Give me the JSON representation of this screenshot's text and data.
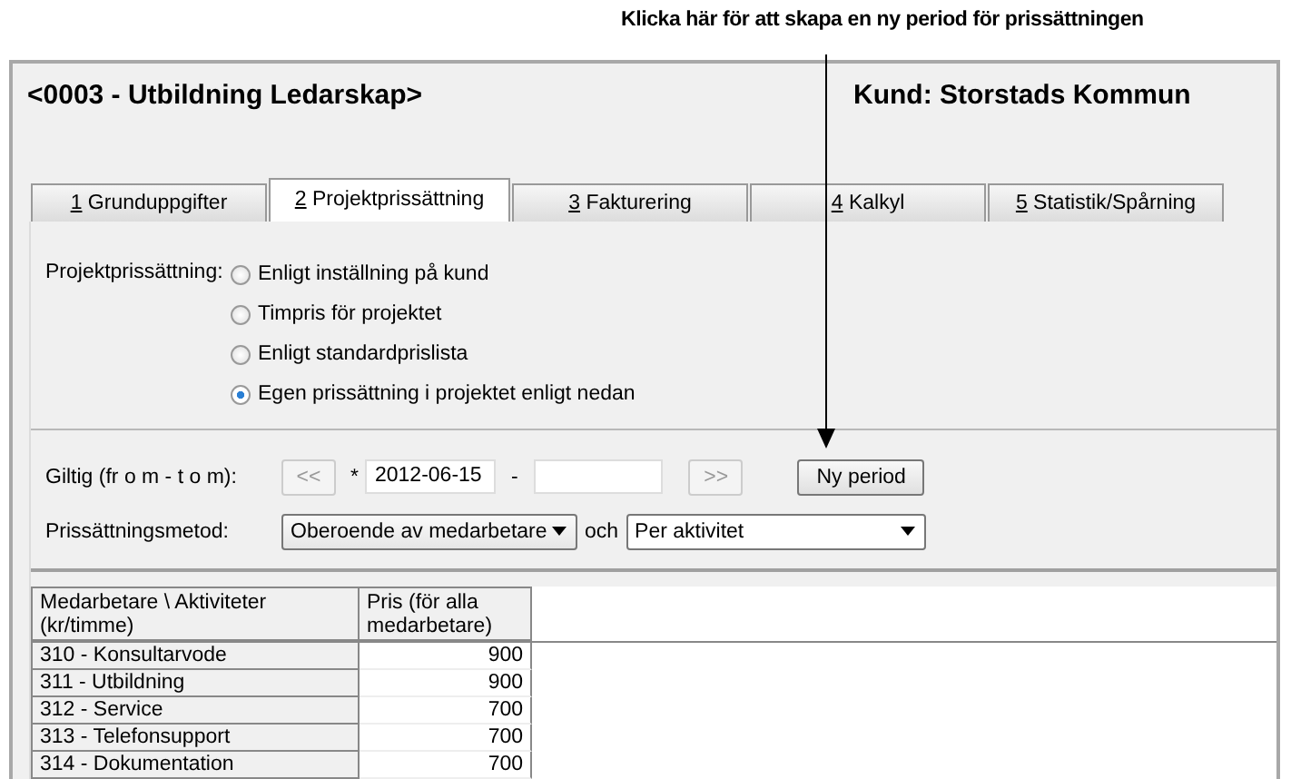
{
  "annotation": {
    "text": "Klicka här för att skapa en ny period för prissättningen"
  },
  "header": {
    "project": "<0003 - Utbildning Ledarskap>",
    "customer": "Kund: Storstads Kommun"
  },
  "tabs": [
    {
      "key": "1",
      "label": " Grunduppgifter",
      "selected": false
    },
    {
      "key": "2",
      "label": " Projektprissättning",
      "selected": true
    },
    {
      "key": "3",
      "label": " Fakturering",
      "selected": false
    },
    {
      "key": "4",
      "label": " Kalkyl",
      "selected": false
    },
    {
      "key": "5",
      "label": " Statistik/Spårning",
      "selected": false
    }
  ],
  "pricing": {
    "label": "Projektprissättning:",
    "options": [
      {
        "label": "Enligt inställning på kund",
        "selected": false
      },
      {
        "label": "Timpris för projektet",
        "selected": false
      },
      {
        "label": "Enligt standardprislista",
        "selected": false
      },
      {
        "label": "Egen prissättning i projektet enligt nedan",
        "selected": true
      }
    ]
  },
  "validity": {
    "label": "Giltig (fr o m - t o m):",
    "prev_button": "<<",
    "required_mark": "*",
    "from_value": "2012-06-15",
    "separator": "-",
    "next_button": ">>",
    "new_period_button": "Ny period"
  },
  "method": {
    "label": "Prissättningsmetod:",
    "employee_select": "Oberoende av medarbetare",
    "joiner": "och",
    "activity_select": "Per aktivitet"
  },
  "table": {
    "columns": [
      "Medarbetare \\ Aktiviteter (kr/timme)",
      "Pris (för alla medarbetare)"
    ],
    "rows": [
      {
        "activity": "310 - Konsultarvode",
        "price": "900"
      },
      {
        "activity": "311 - Utbildning",
        "price": "900"
      },
      {
        "activity": "312 - Service",
        "price": "700"
      },
      {
        "activity": "313 - Telefonsupport",
        "price": "700"
      },
      {
        "activity": "314 - Dokumentation",
        "price": "700"
      }
    ]
  }
}
